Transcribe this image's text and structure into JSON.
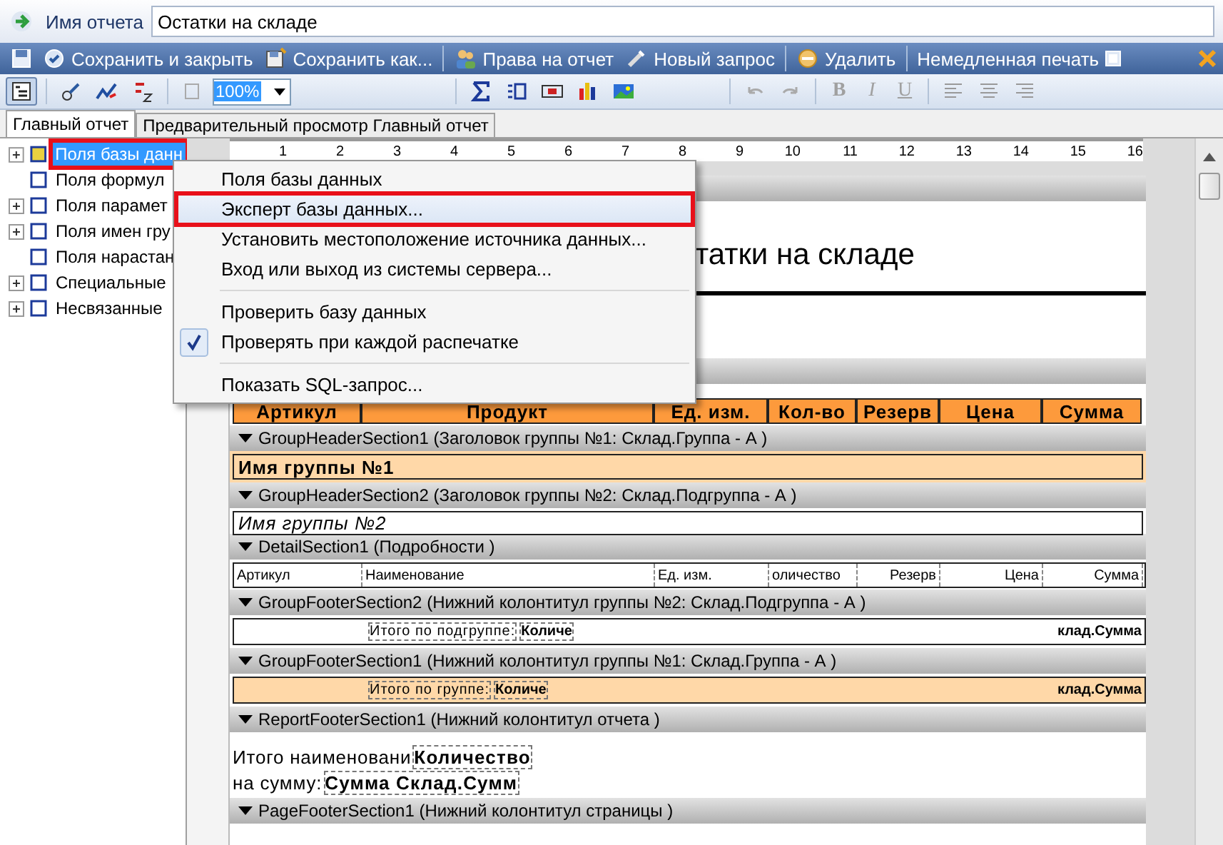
{
  "report_name": {
    "label": "Имя отчета",
    "value": "Остатки на складе"
  },
  "action_groups": [
    [
      {
        "label": "Сохранить и закрыть"
      },
      {
        "label": "Сохранить как..."
      }
    ],
    [
      {
        "label": "Права на отчет"
      },
      {
        "label": "Новый запрос"
      }
    ],
    [
      {
        "label": "Удалить"
      }
    ]
  ],
  "instant_print": {
    "label": "Немедленная печать",
    "checked": false
  },
  "zoom": {
    "value": "100%"
  },
  "format_buttons": [
    {
      "label": "B",
      "disabled": true
    },
    {
      "label": "I",
      "disabled": true
    },
    {
      "label": "U",
      "disabled": true
    }
  ],
  "tabs": [
    {
      "label": "Главный отчет",
      "selected": true
    },
    {
      "label": "Предварительный просмотр Главный отчет",
      "selected": false
    }
  ],
  "tree": [
    {
      "label": "Поля базы данн",
      "has_children": true,
      "selected": true
    },
    {
      "label": "Поля формул",
      "has_children": false,
      "selected": false
    },
    {
      "label": "Поля парамет",
      "has_children": true,
      "selected": false
    },
    {
      "label": "Поля имен гру",
      "has_children": true,
      "selected": false
    },
    {
      "label": "Поля нарастан",
      "has_children": false,
      "selected": false
    },
    {
      "label": "Специальные",
      "has_children": true,
      "selected": false
    },
    {
      "label": "Несвязанные",
      "has_children": true,
      "selected": false
    }
  ],
  "ruler": [
    "1",
    "2",
    "3",
    "4",
    "5",
    "6",
    "7",
    "8",
    "9",
    "10",
    "11",
    "12",
    "13",
    "14",
    "15",
    "16"
  ],
  "sections": [
    {
      "kind": "bar"
    },
    {
      "kind": "title",
      "text": "татки на складе"
    },
    {
      "kind": "bar"
    },
    {
      "kind": "header",
      "cells": [
        "Артикул",
        "Продукт",
        "Ед. изм.",
        "Кол-во",
        "Резерв",
        "Цена",
        "Сумма"
      ]
    },
    {
      "kind": "bar",
      "label": "GroupHeaderSection1 (Заголовок группы №1: Склад.Группа - А )"
    },
    {
      "kind": "group_header",
      "color": "#ffd8a8",
      "text": "Имя группы №1"
    },
    {
      "kind": "bar",
      "label": "GroupHeaderSection2 (Заголовок группы №2: Склад.Подгруппа - А )"
    },
    {
      "kind": "subgroup_header",
      "color": "#ffffff",
      "text": "Имя группы №2"
    },
    {
      "kind": "bar",
      "label": "DetailSection1 (Подробности  )"
    },
    {
      "kind": "detail",
      "cells": [
        "Артикул",
        "Наименование",
        "Ед. изм.",
        "оличество",
        "Резерв",
        "Цена",
        "Сумма"
      ]
    },
    {
      "kind": "bar",
      "label": "GroupFooterSection2 (Нижний колонтитул группы №2: Склад.Подгруппа - А )"
    },
    {
      "kind": "totals",
      "color": "#ffffff",
      "label": "Итого по подгруппе:",
      "value": "Количе",
      "sum": "клад.Сумма"
    },
    {
      "kind": "bar",
      "label": "GroupFooterSection1 (Нижний колонтитул группы №1: Склад.Группа - А )"
    },
    {
      "kind": "totals",
      "color": "#ffd8a8",
      "label": "Итого по группе:",
      "value": "Количе",
      "sum": "клад.Сумма"
    },
    {
      "kind": "bar",
      "label": "ReportFooterSection1 (Нижний колонтитул отчета  )"
    },
    {
      "kind": "summary",
      "lines": [
        {
          "label": "Итого наименовани",
          "value": "Количество"
        },
        {
          "label": "на сумму:",
          "value": "Сумма Склад.Сумм"
        }
      ]
    },
    {
      "kind": "bar",
      "label": "PageFooterSection1 (Нижний колонтитул страницы  )"
    },
    {
      "kind": "blank"
    }
  ],
  "context_menu": [
    {
      "label": "Поля базы данных",
      "checked": false,
      "selected": false
    },
    {
      "label": "Эксперт базы данных...",
      "checked": false,
      "selected": true
    },
    {
      "label": "Установить местоположение источника данных...",
      "checked": false,
      "selected": false
    },
    {
      "label": "Вход или выход из системы сервера...",
      "checked": false,
      "selected": false,
      "separator_after": true
    },
    {
      "label": "Проверить базу данных",
      "checked": false,
      "selected": false
    },
    {
      "label": "Проверять при каждой распечатке",
      "checked": true,
      "selected": false,
      "separator_after": true
    },
    {
      "label": "Показать SQL-запрос...",
      "checked": false,
      "selected": false
    }
  ]
}
